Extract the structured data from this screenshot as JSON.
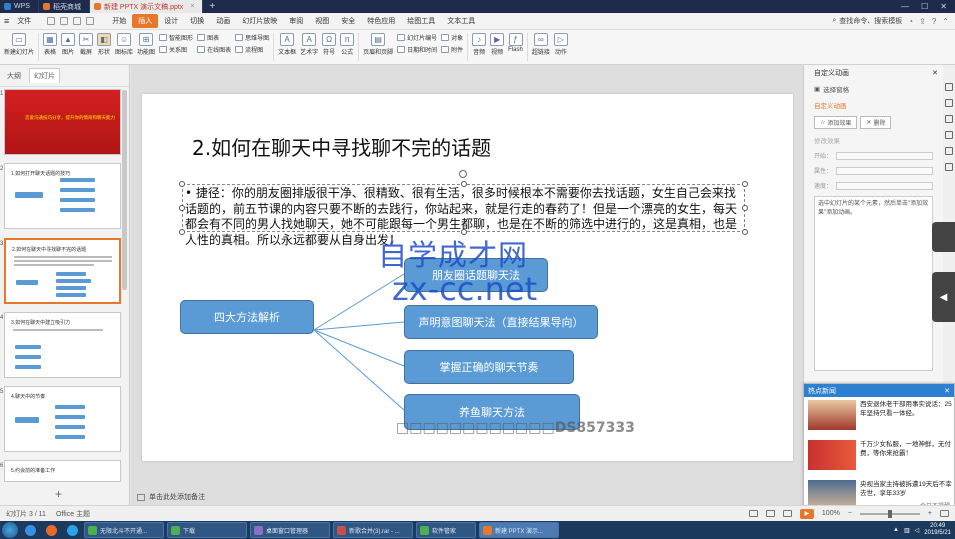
{
  "titlebar": {
    "tabs": [
      {
        "label": "WPS",
        "color": "#2d7fd1",
        "active": false
      },
      {
        "label": "稻壳商城",
        "color": "#e8762b",
        "active": false
      },
      {
        "label": "新建 PPTX 演示文稿.pptx",
        "color": "#e8762b",
        "active": true
      }
    ],
    "add_tab": "+"
  },
  "menubar": {
    "file_label": "文件",
    "items": [
      "开始",
      "插入",
      "设计",
      "切换",
      "动画",
      "幻灯片放映",
      "审阅",
      "视图",
      "安全",
      "特色应用",
      "绘图工具",
      "文本工具"
    ],
    "active_index": 1,
    "search_label": "查找命令、搜索模板"
  },
  "ribbon": {
    "new_slide": "新建幻灯片",
    "table": "表格",
    "picture": "图片",
    "screenshot": "截屏",
    "shape": "形状",
    "icon_lib": "图标库",
    "function_chart": "功能图",
    "smartart": "智能图形",
    "relation": "关系图",
    "chart": "图表",
    "online_chart": "在线图表",
    "mindmap": "思维导图",
    "flowchart": "流程图",
    "textbox": "文本框",
    "wordart": "艺术字",
    "symbol": "符号",
    "formula": "公式",
    "header_footer": "页眉和页脚",
    "slide_number": "幻灯片编号",
    "date_time": "日期和时间",
    "object": "对象",
    "attachment": "附件",
    "audio": "音频",
    "video": "视频",
    "flash": "Flash",
    "hyperlink": "超链接",
    "action": "动作"
  },
  "leftpanel": {
    "tab_outline": "大纲",
    "tab_slides": "幻灯片",
    "thumbs": [
      {
        "num": "1",
        "title": "恋爱沟通技巧分享，提升你的情商和聊天能力"
      },
      {
        "num": "2",
        "title": "1.如何打开聊天话题的技巧"
      },
      {
        "num": "3",
        "title": "2.如何在聊天中寻找聊不完的话题"
      },
      {
        "num": "4",
        "title": "3.如何在聊天中建立吸引力"
      },
      {
        "num": "5",
        "title": "4.聊天中的节奏"
      },
      {
        "num": "6",
        "title": "5.约会前的准备工作"
      }
    ],
    "add_slide": "+"
  },
  "slide": {
    "title": "2.如何在聊天中寻找聊不完的话题",
    "bullet": "捷径：你的朋友圈排版很干净、很精致、很有生活，很多时候根本不需要你去找话题，女生自己会来找话题的，前五节课的内容只要不断的去践行，你站起来，就是行走的春药了！但是一个漂亮的女生，每天都会有不同的男人找她聊天，她不可能跟每一个男生都聊，也是在不断的筛选中进行的，这是真相，也是人性的真相。所以永远都要从自身出发！",
    "diagram": {
      "root": "四大方法解析",
      "branches": [
        "朋友圈话题聊天法",
        "声明意图聊天法（直接结果导向）",
        "掌握正确的聊天节奏",
        "养鱼聊天方法"
      ],
      "fill": "#5b9bd5"
    },
    "watermark_cn": "自学成才网",
    "watermark_url": "zx-cc.net",
    "watermark_code": "□□□□□□□□□□□□DS857333"
  },
  "notes": {
    "placeholder": "单击此处添加备注"
  },
  "rightpanel": {
    "title": "自定义动画",
    "select_pane": "选择窗格",
    "custom_anim": "自定义动画",
    "add_effect": "添加效果",
    "delete": "删除",
    "modify_effect": "修改效果",
    "start_label": "开始：",
    "property_label": "属性：",
    "speed_label": "速度：",
    "hint": "选中幻灯片的某个元素，然后单击\"添加效果\"添加动画。"
  },
  "news": {
    "header": "热点新闻",
    "items": [
      {
        "text": "西安退休老干部用事实说话：25年坚持只看一体经。"
      },
      {
        "text": "千万少女私服，一地神鲜，无付费，等你来抢霸！"
      },
      {
        "text": "央视当家主持被拆遭19天后不幸去世，享年33岁"
      }
    ],
    "footer": "今日不提醒"
  },
  "statusbar": {
    "slide_info": "幻灯片 3 / 11",
    "theme": "Office 主题",
    "zoom": "100%"
  },
  "taskbar": {
    "tasks": [
      {
        "label": "无限北斗不开通...",
        "color": "#4caf50"
      },
      {
        "label": "下载",
        "color": "#4caf50"
      },
      {
        "label": "桌面窗口管理器",
        "color": "#8a6fc5"
      },
      {
        "label": "新歌合并(3).rar - ...",
        "color": "#c94f4f"
      },
      {
        "label": "软件管家",
        "color": "#4caf50"
      },
      {
        "label": "新建 PPTX 演示...",
        "color": "#e8762b"
      }
    ],
    "time": "20:49",
    "date": "2019/5/21"
  }
}
